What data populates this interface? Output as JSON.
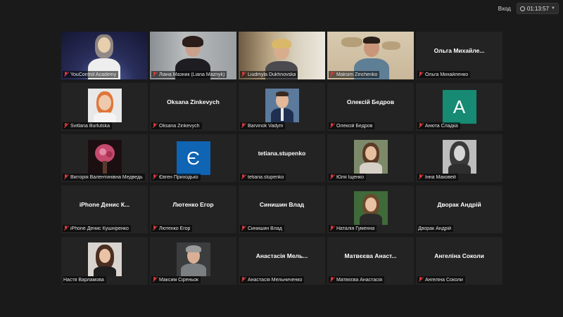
{
  "topbar": {
    "enter_label": "Вход",
    "timer": "01:13:57"
  },
  "colors": {
    "active_speaker_border": "#d8db6f",
    "muted_mic": "#d23a3a",
    "tile_bg": "#232323"
  },
  "participants": [
    {
      "name": "YouControl Academy",
      "display": "video"
    },
    {
      "name": "Ліана Мазник (Liana Maznyk)",
      "display": "video"
    },
    {
      "name": "Liudmyla Dukhnovska",
      "display": "video",
      "active": true
    },
    {
      "name": "Maksim Zinchenko",
      "display": "video"
    },
    {
      "name": "Ольга Михайленко",
      "display": "name",
      "big": "Ольга Михайле..."
    },
    {
      "name": "Svitlana Burlutska",
      "display": "photo"
    },
    {
      "name": "Oksana Zinkevych",
      "display": "name",
      "big": "Oksana Zinkevych"
    },
    {
      "name": "Barvinok Vadym",
      "display": "photo"
    },
    {
      "name": "Олексій Бедров",
      "display": "name",
      "big": "Олексій Бедров"
    },
    {
      "name": "Анюта Сладка",
      "display": "letter",
      "letter": "А"
    },
    {
      "name": "Вікторія Валентинівна Медведь",
      "display": "photo"
    },
    {
      "name": "Євген Приходько",
      "display": "letter",
      "letter": "Є"
    },
    {
      "name": "tetiana.stupenko",
      "display": "name",
      "big": "tetiana.stupenko"
    },
    {
      "name": "Юля Іщенко",
      "display": "photo"
    },
    {
      "name": "Інна Маковей",
      "display": "photo"
    },
    {
      "name": "iPhone Денис Кушніренко",
      "display": "name",
      "big": "iPhone Денис К..."
    },
    {
      "name": "Лютенко Егор",
      "display": "name",
      "big": "Лютенко Егор"
    },
    {
      "name": "Синишин Влад",
      "display": "name",
      "big": "Синишин Влад"
    },
    {
      "name": "Наталія Гуменна",
      "display": "photo"
    },
    {
      "name": "Дворак Андрій",
      "display": "name",
      "big": "Дворак Андрій"
    },
    {
      "name": "Настя Варламова",
      "display": "photo"
    },
    {
      "name": "Максим Сіреньок",
      "display": "photo"
    },
    {
      "name": "Анастасія Мельниченко",
      "display": "name",
      "big": "Анастасія Мель..."
    },
    {
      "name": "Матвєєва Анастасія",
      "display": "name",
      "big": "Матвєєва Анаст..."
    },
    {
      "name": "Ангеліна Соколи",
      "display": "name",
      "big": "Ангеліна Соколи"
    }
  ]
}
